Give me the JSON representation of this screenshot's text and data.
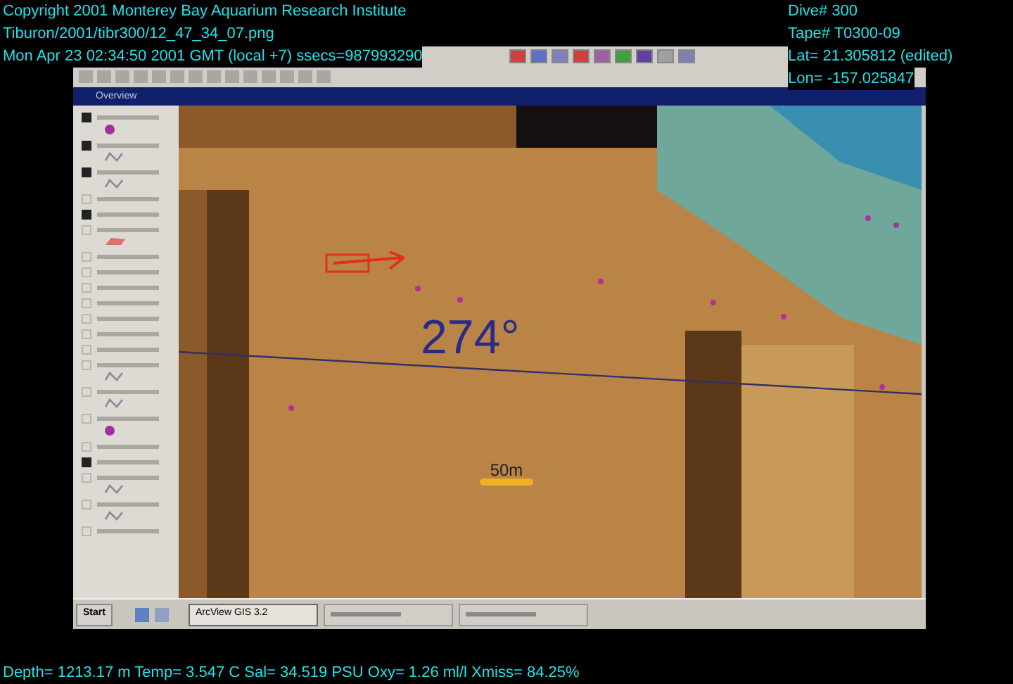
{
  "overlay": {
    "top_left": [
      "Copyright 2001 Monterey Bay Aquarium Research Institute",
      "Tiburon/2001/tibr300/12_47_34_07.png",
      "Mon Apr 23 02:34:50 2001 GMT (local +7) ssecs=987993290"
    ],
    "top_right": [
      "Dive# 300",
      "Tape# T0300-09",
      "Lat= 21.305812 (edited)",
      "Lon= -157.025847"
    ],
    "bottom": "Depth= 1213.17 m  Temp= 3.547 C  Sal= 34.519 PSU  Oxy= 1.26 ml/l  Xmiss= 84.25%"
  },
  "app": {
    "window_title": "Overview",
    "layers": [
      {
        "kind": "dot",
        "checked": true
      },
      {
        "kind": "line",
        "checked": true
      },
      {
        "kind": "line",
        "checked": true
      },
      {
        "kind": "none",
        "checked": false
      },
      {
        "kind": "none",
        "checked": true
      },
      {
        "kind": "polygon",
        "checked": false
      },
      {
        "kind": "none",
        "checked": false
      },
      {
        "kind": "none",
        "checked": false
      },
      {
        "kind": "none",
        "checked": false
      },
      {
        "kind": "none",
        "checked": false
      },
      {
        "kind": "none",
        "checked": false
      },
      {
        "kind": "none",
        "checked": false
      },
      {
        "kind": "none",
        "checked": false
      },
      {
        "kind": "line",
        "checked": false
      },
      {
        "kind": "line",
        "checked": false
      },
      {
        "kind": "dot",
        "checked": false
      },
      {
        "kind": "none",
        "checked": false
      },
      {
        "kind": "none",
        "checked": true
      },
      {
        "kind": "line",
        "checked": false
      },
      {
        "kind": "line",
        "checked": false
      },
      {
        "kind": "none",
        "checked": false
      }
    ],
    "map": {
      "heading": "274°",
      "scale_label": "50m"
    }
  },
  "taskbar": {
    "start": "Start",
    "tasks": [
      {
        "label": "ArcView GIS 3.2",
        "selected": true
      },
      {
        "selected": false
      },
      {
        "selected": false
      }
    ]
  }
}
